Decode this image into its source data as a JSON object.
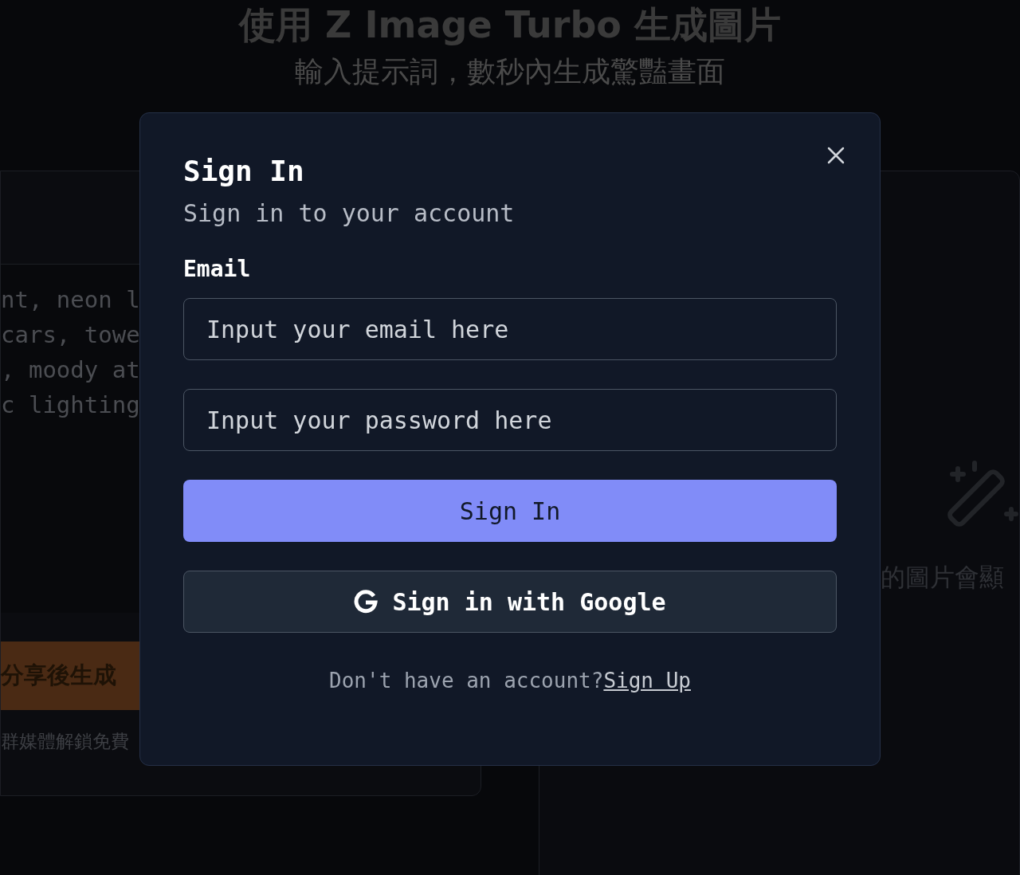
{
  "background": {
    "title": "使用 Z Image Turbo 生成圖片",
    "subtitle": "輸入提示詞，數秒內生成驚豔畫面",
    "prompt_lines": [
      "nt, neon l",
      "cars, towe",
      ", moody at",
      "c lighting"
    ],
    "share_button": "分享後生成",
    "share_note": "群媒體解鎖免費",
    "result_hint": "的圖片會顯"
  },
  "dialog": {
    "title": "Sign In",
    "subtitle": "Sign in to your account",
    "email_label": "Email",
    "email_placeholder": "Input your email here",
    "password_placeholder": "Input your password here",
    "submit_button": "Sign In",
    "google_button": "Sign in with Google",
    "footer_text": "Don't have an account?",
    "footer_link": "Sign Up"
  }
}
